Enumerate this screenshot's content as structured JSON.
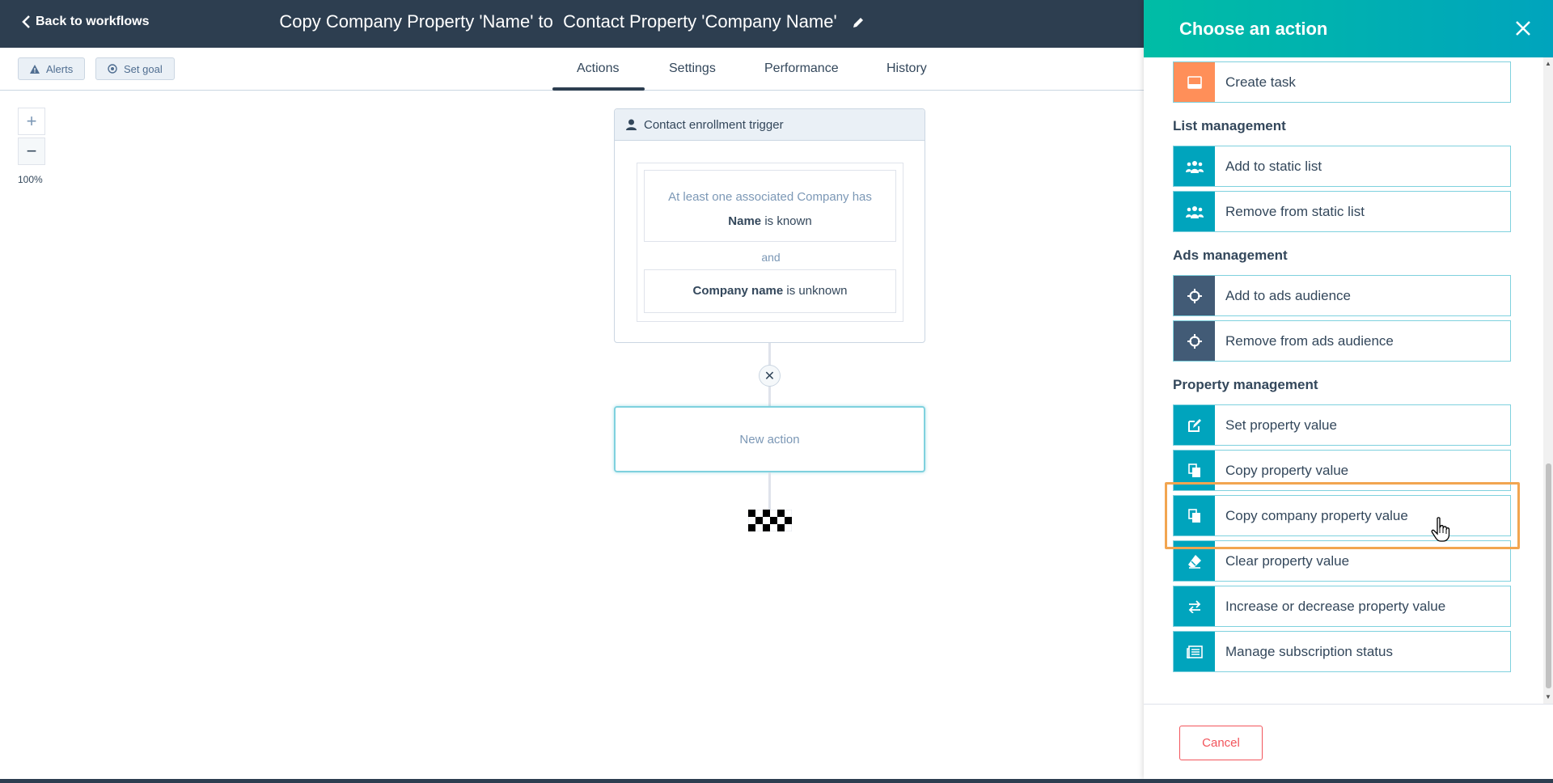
{
  "header": {
    "back_label": "Back to workflows",
    "title": "Copy Company Property 'Name' to  Contact Property 'Company Name'"
  },
  "toolbar": {
    "alerts_label": "Alerts",
    "set_goal_label": "Set goal"
  },
  "tabs": [
    {
      "label": "Actions",
      "active": true
    },
    {
      "label": "Settings",
      "active": false
    },
    {
      "label": "Performance",
      "active": false
    },
    {
      "label": "History",
      "active": false
    }
  ],
  "zoom": {
    "plus": "+",
    "minus": "−",
    "level": "100%"
  },
  "trigger": {
    "title": "Contact enrollment trigger",
    "criteria_1_intro": "At least one associated Company has",
    "criteria_1_property": "Name",
    "criteria_1_operator": " is known",
    "joiner": "and",
    "criteria_2_property": "Company name",
    "criteria_2_operator": " is unknown"
  },
  "new_action": {
    "label": "New action"
  },
  "panel": {
    "title": "Choose an action",
    "sections": {
      "list_management": "List management",
      "ads_management": "Ads management",
      "property_management": "Property management"
    },
    "actions": {
      "create_task": "Create task",
      "add_static_list": "Add to static list",
      "remove_static_list": "Remove from static list",
      "add_ads_audience": "Add to ads audience",
      "remove_ads_audience": "Remove from ads audience",
      "set_property": "Set property value",
      "copy_property": "Copy property value",
      "copy_company_property": "Copy company property value",
      "clear_property": "Clear property value",
      "increase_decrease_property": "Increase or decrease property value",
      "manage_subscription": "Manage subscription status"
    },
    "cancel_label": "Cancel"
  },
  "colors": {
    "header_bg": "#2d3e50",
    "panel_gradient_start": "#00bda5",
    "panel_gradient_end": "#00a4bd",
    "icon_teal": "#00a4bd",
    "icon_orange": "#ff8f59",
    "icon_slate": "#425b76",
    "highlight": "#f2a550",
    "cancel": "#f2545b"
  }
}
